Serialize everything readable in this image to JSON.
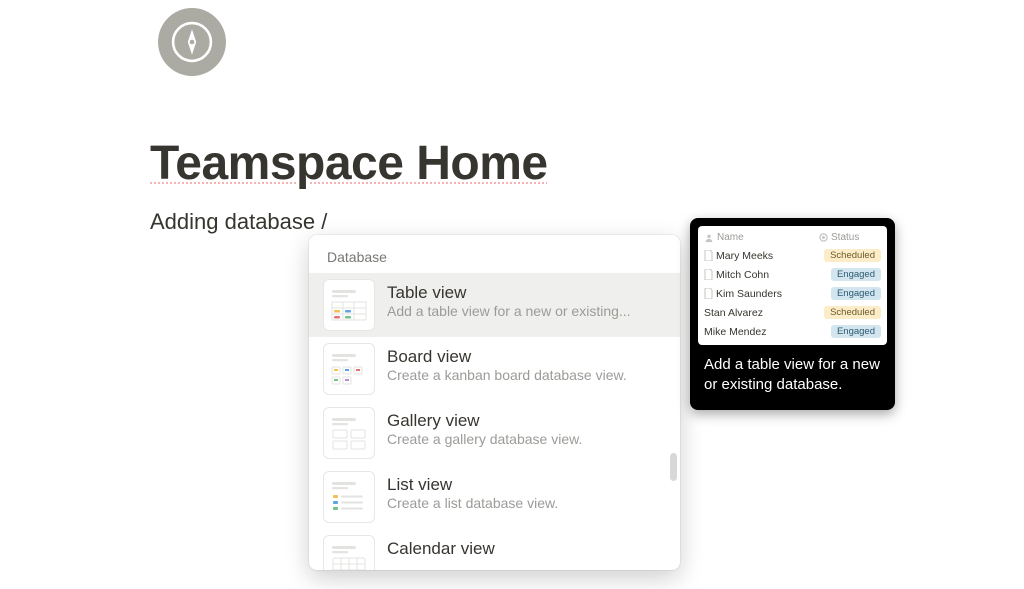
{
  "page": {
    "title": "Teamspace Home",
    "input_text": "Adding database /"
  },
  "menu": {
    "section_label": "Database",
    "items": [
      {
        "title": "Table view",
        "desc": "Add a table view for a new or existing..."
      },
      {
        "title": "Board view",
        "desc": "Create a kanban board database view."
      },
      {
        "title": "Gallery view",
        "desc": "Create a gallery database view."
      },
      {
        "title": "List view",
        "desc": "Create a list database view."
      },
      {
        "title": "Calendar view",
        "desc": ""
      }
    ]
  },
  "tooltip": {
    "text": "Add a table view for a new or existing database.",
    "preview": {
      "columns": {
        "name": "Name",
        "status": "Status"
      },
      "rows": [
        {
          "name": "Mary Meeks",
          "status": "Scheduled",
          "status_class": "scheduled"
        },
        {
          "name": "Mitch Cohn",
          "status": "Engaged",
          "status_class": "engaged"
        },
        {
          "name": "Kim Saunders",
          "status": "Engaged",
          "status_class": "engaged"
        },
        {
          "name": "Stan Alvarez",
          "status": "Scheduled",
          "status_class": "scheduled"
        },
        {
          "name": "Mike Mendez",
          "status": "Engaged",
          "status_class": "engaged"
        }
      ]
    }
  }
}
